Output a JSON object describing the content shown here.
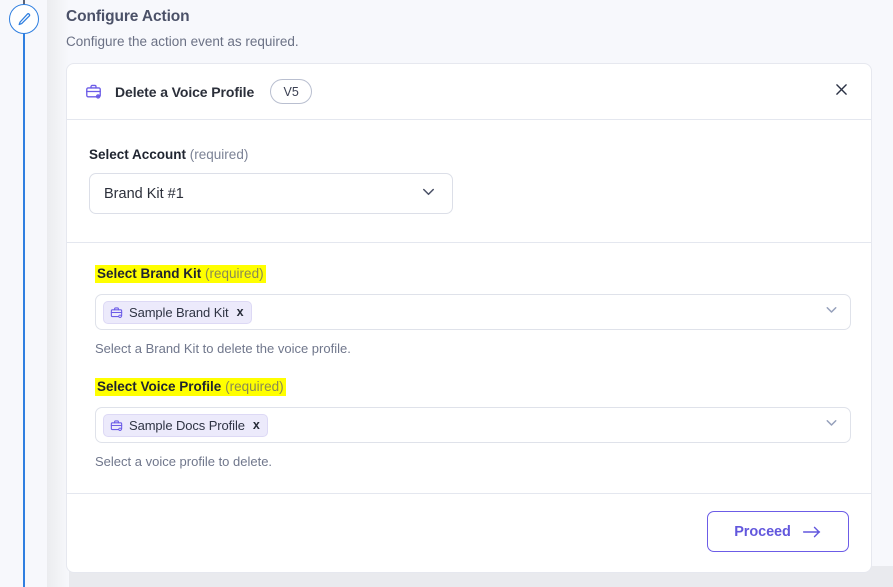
{
  "page": {
    "title": "Configure Action",
    "subtitle": "Configure the action event as required."
  },
  "rail": {
    "node_icon": "pencil-edit-icon",
    "line_color": "#2f7fe0"
  },
  "card": {
    "header": {
      "icon": "briefcase-icon",
      "title": "Delete a Voice Profile",
      "version_badge": "V5",
      "close_icon": "close-icon"
    },
    "account_field": {
      "label": "Select Account",
      "required_text": "(required)",
      "selected_value": "Brand Kit #1",
      "chevron_icon": "chevron-down-icon"
    },
    "brand_kit_field": {
      "label": "Select Brand Kit",
      "required_text": "(required)",
      "highlighted": true,
      "chip": {
        "icon": "briefcase-icon",
        "label": "Sample Brand Kit",
        "remove_icon": "x"
      },
      "help_text": "Select a Brand Kit to delete the voice profile.",
      "chevron_icon": "chevron-down-icon"
    },
    "voice_profile_field": {
      "label": "Select Voice Profile",
      "required_text": "(required)",
      "highlighted": true,
      "chip": {
        "icon": "briefcase-icon",
        "label": "Sample Docs Profile",
        "remove_icon": "x"
      },
      "help_text": "Select a voice profile to delete.",
      "chevron_icon": "chevron-down-icon"
    },
    "footer": {
      "proceed_label": "Proceed",
      "proceed_icon": "arrow-right-icon"
    }
  },
  "colors": {
    "accent_purple": "#6c5ce7",
    "timeline_blue": "#2f7fe0",
    "highlight_yellow": "#ffff00",
    "page_background": "#f7f8fc"
  }
}
